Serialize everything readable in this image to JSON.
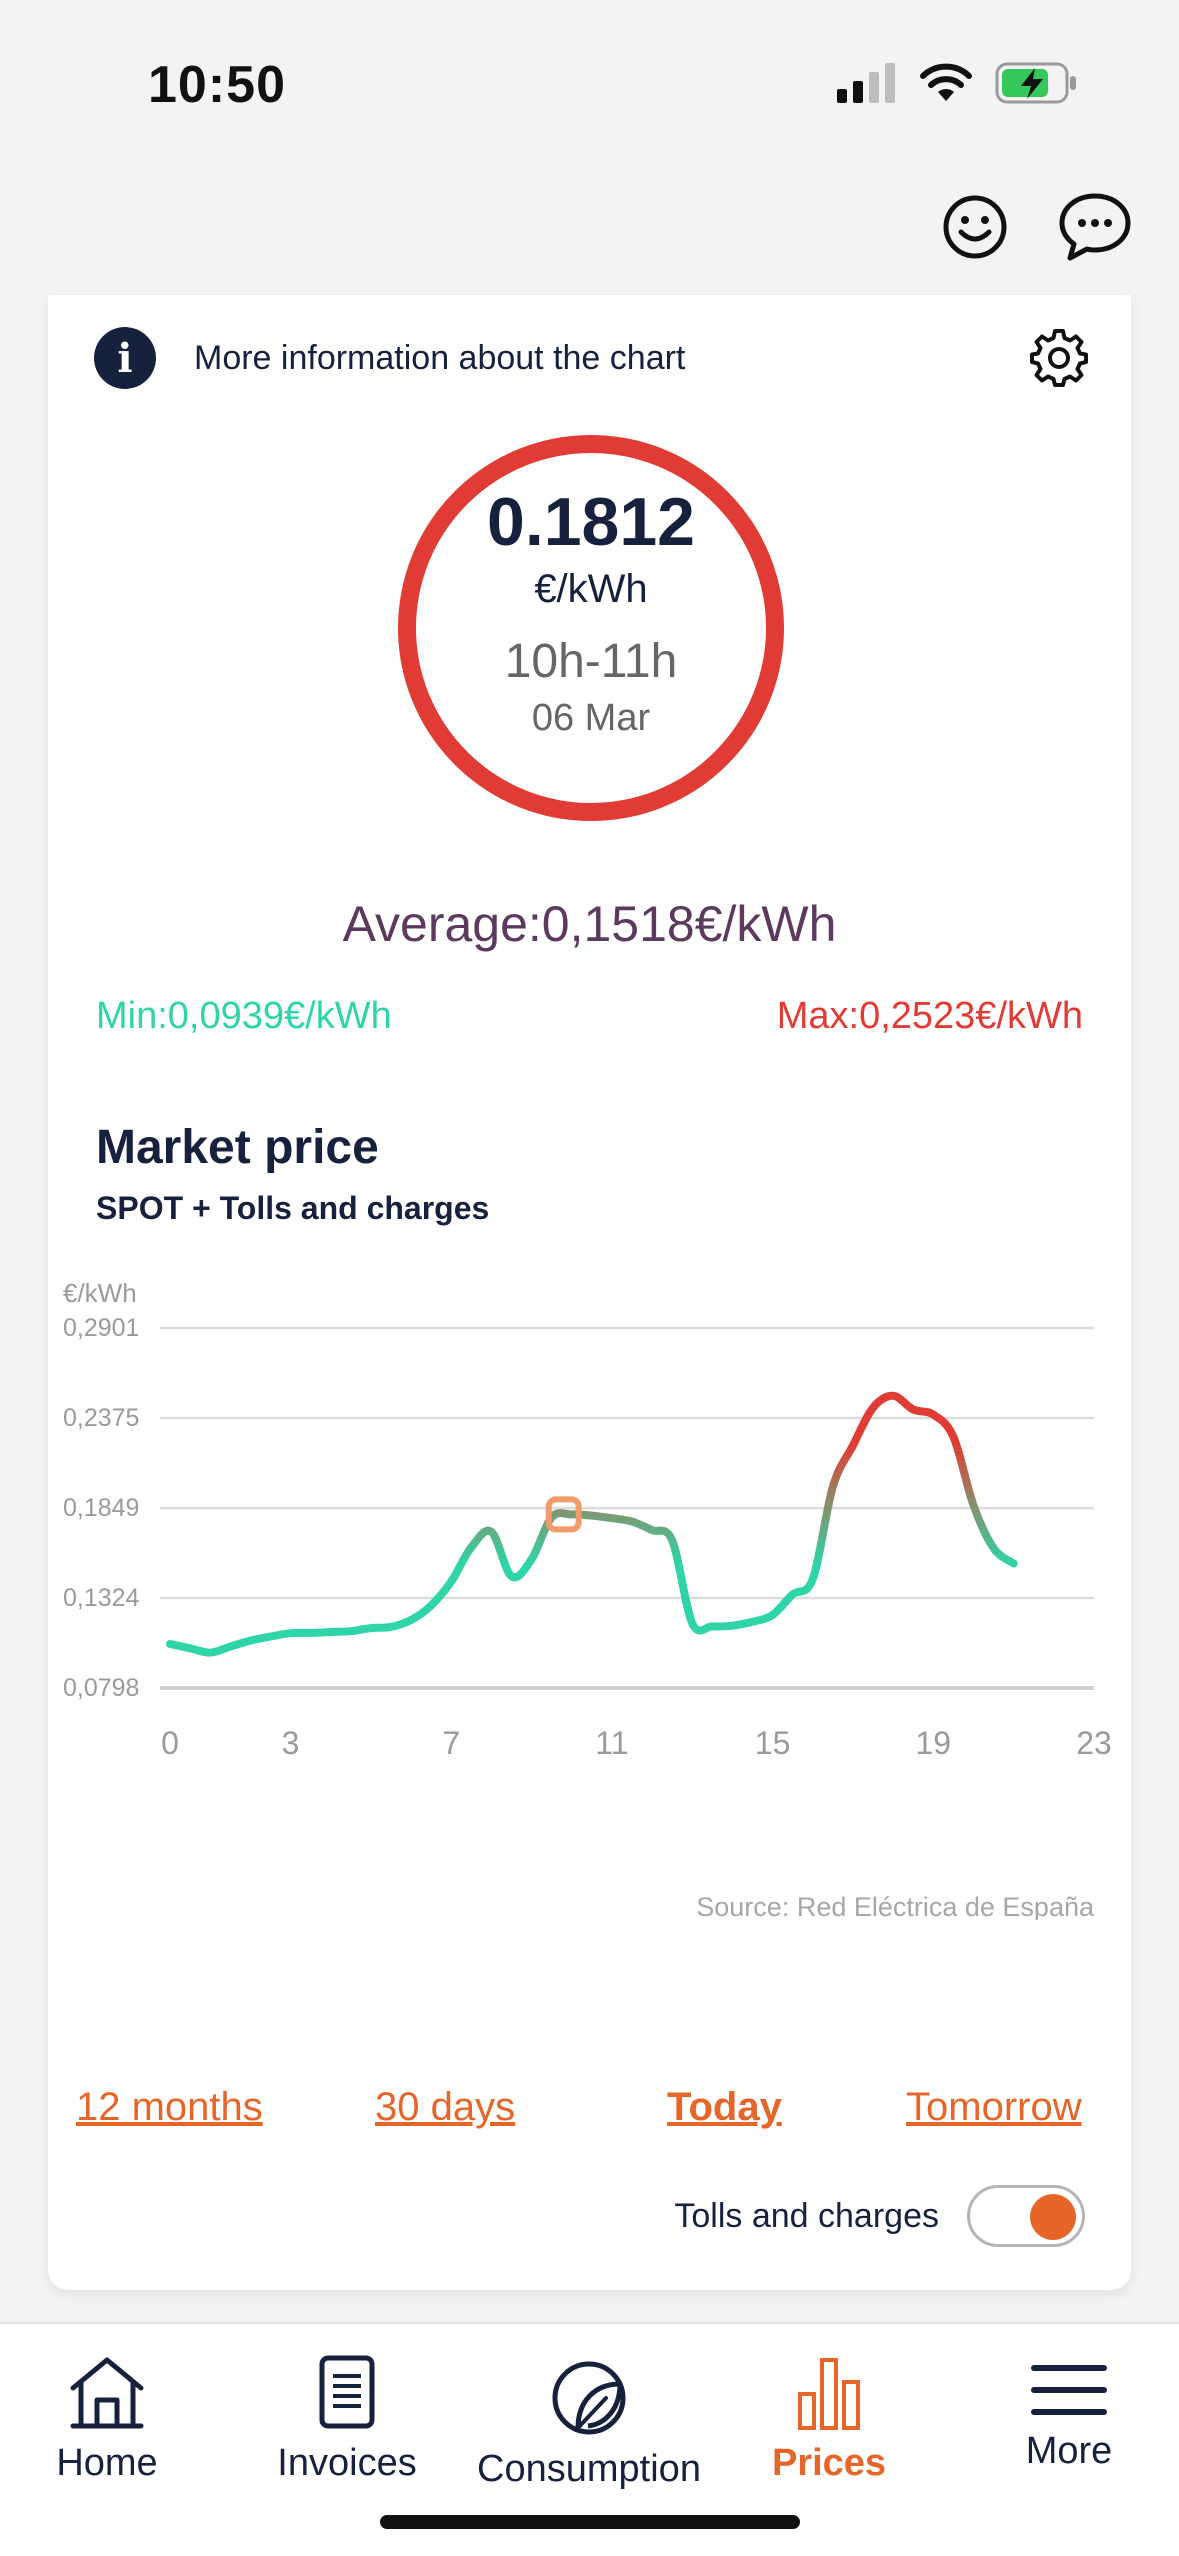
{
  "status": {
    "time": "10:50"
  },
  "info": {
    "text": "More information about the chart"
  },
  "price": {
    "value": "0.1812",
    "unit": "€/kWh",
    "hours": "10h-11h",
    "date": "06 Mar"
  },
  "stats": {
    "average": "Average:0,1518€/kWh",
    "min": "Min:0,0939€/kWh",
    "max": "Max:0,2523€/kWh"
  },
  "market": {
    "title": "Market price",
    "subtitle": "SPOT + Tolls and charges"
  },
  "chart_data": {
    "type": "line",
    "ylabel": "€/kWh",
    "ylim": [
      0.0798,
      0.2901
    ],
    "yticks": [
      "0,2901",
      "0,2375",
      "0,1849",
      "0,1324",
      "0,0798"
    ],
    "ytick_values": [
      0.2901,
      0.2375,
      0.1849,
      0.1324,
      0.0798
    ],
    "xlim": [
      0,
      23
    ],
    "xticks": [
      "0",
      "3",
      "7",
      "11",
      "15",
      "19",
      "23"
    ],
    "xtick_values": [
      0,
      3,
      7,
      11,
      15,
      19,
      23
    ],
    "x": [
      0,
      0.5,
      1,
      1.5,
      2,
      2.5,
      3,
      3.5,
      4,
      4.5,
      5,
      5.5,
      6,
      6.5,
      7,
      7.5,
      8,
      8.5,
      9,
      9.5,
      10,
      10.5,
      11,
      11.5,
      12,
      12.5,
      13,
      13.5,
      14,
      14.5,
      15,
      15.5,
      16,
      16.5,
      17,
      17.5,
      18,
      18.5,
      19,
      19.5,
      20,
      20.5,
      21,
      21.5,
      22,
      22.5,
      23
    ],
    "values": [
      0.1055,
      0.103,
      0.1005,
      0.104,
      0.1075,
      0.1098,
      0.1118,
      0.112,
      0.1125,
      0.113,
      0.1148,
      0.1155,
      0.1195,
      0.128,
      0.142,
      0.162,
      0.171,
      0.145,
      0.155,
      0.1795,
      0.1812,
      0.1805,
      0.179,
      0.177,
      0.172,
      0.166,
      0.1175,
      0.1158,
      0.1162,
      0.1185,
      0.1225,
      0.1345,
      0.1435,
      0.1975,
      0.2215,
      0.2435,
      0.2505,
      0.2425,
      0.2395,
      0.2265,
      0.1865,
      0.1615,
      0.1525
    ],
    "highlight": {
      "x": 9.8,
      "y": 0.1812
    },
    "source": "Source: Red Eléctrica de España",
    "colors": {
      "low": "#2fd4a7",
      "mid": "#8a8f6a",
      "high": "#e03c35",
      "highlight": "#f29b6c"
    },
    "grid": true
  },
  "ranges": {
    "months": "12 months",
    "days": "30 days",
    "today": "Today",
    "tomorrow": "Tomorrow"
  },
  "toggle": {
    "label": "Tolls and charges",
    "on": true
  },
  "nav": {
    "home": "Home",
    "invoices": "Invoices",
    "consumption": "Consumption",
    "prices": "Prices",
    "more": "More"
  },
  "colors": {
    "accent": "#e6662a",
    "navy": "#16213e",
    "red": "#e03c35",
    "green": "#2fd4a7"
  }
}
